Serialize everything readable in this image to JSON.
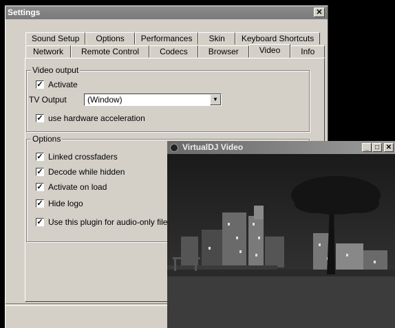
{
  "window": {
    "title": "Settings",
    "close_glyph": "✕"
  },
  "tabs_row1": [
    "Sound Setup",
    "Options",
    "Performances",
    "Skin",
    "Keyboard Shortcuts"
  ],
  "tabs_row2": [
    "Network",
    "Remote Control",
    "Codecs",
    "Browser",
    "Video",
    "Info"
  ],
  "active_tab": "Video",
  "video_output": {
    "label": "Video output",
    "activate": {
      "label": "Activate",
      "checked": true
    },
    "tv_output": {
      "label": "TV Output",
      "value": "(Window)"
    },
    "hw_accel": {
      "label": "use hardware acceleration",
      "checked": true
    }
  },
  "options": {
    "label": "Options",
    "items": [
      {
        "label": "Linked crossfaders",
        "checked": true
      },
      {
        "label": "Decode while hidden",
        "checked": true
      },
      {
        "label": "Activate on load",
        "checked": true
      },
      {
        "label": "Hide logo",
        "checked": true
      },
      {
        "label": "Use this plugin for audio-only files",
        "checked": true
      }
    ]
  },
  "video_window": {
    "title": "VirtualDJ Video",
    "min_glyph": "_",
    "max_glyph": "□",
    "close_glyph": "✕"
  },
  "colors": {
    "titlebar": "#7a7a7a",
    "dialog": "#d4d0c8",
    "video_bg": "#1e1e1e"
  },
  "check_glyph": "✓"
}
